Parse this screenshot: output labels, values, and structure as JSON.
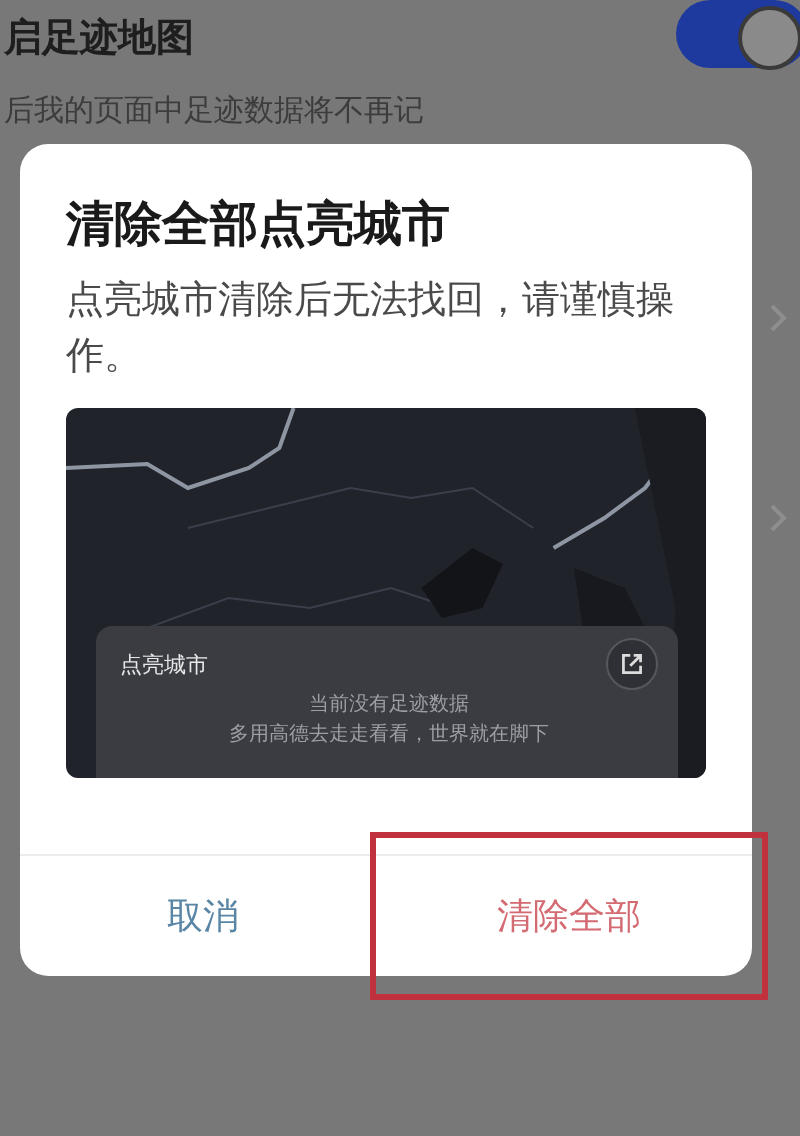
{
  "background_page": {
    "setting": {
      "title": "启足迹地图",
      "description": "后我的页面中足迹数据将不再记",
      "on": true
    }
  },
  "dialog": {
    "title": "清除全部点亮城市",
    "message": "点亮城市清除后无法找回，请谨慎操作。",
    "preview": {
      "card": {
        "title": "点亮城市",
        "empty_lines": [
          "当前没有足迹数据",
          "多用高德去走走看看，世界就在脚下"
        ]
      }
    },
    "buttons": [
      {
        "label": "取消",
        "kind": "cancel",
        "highlighted": false
      },
      {
        "label": "清除全部",
        "kind": "destructive",
        "highlighted": true
      }
    ]
  }
}
